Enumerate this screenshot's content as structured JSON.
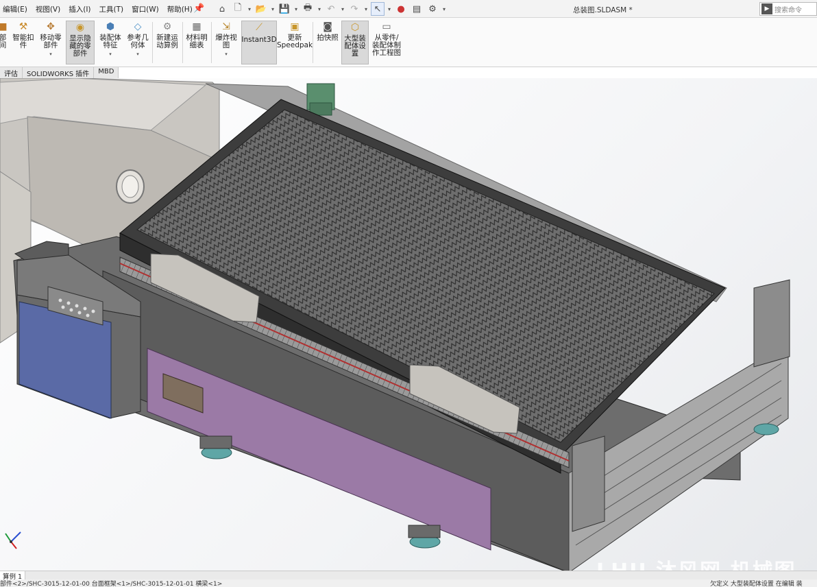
{
  "menu": [
    "编辑(E)",
    "视图(V)",
    "插入(I)",
    "工具(T)",
    "窗口(W)",
    "帮助(H)"
  ],
  "document_title": "总装图.SLDASM *",
  "search": {
    "placeholder": "搜索命令"
  },
  "ribbon": {
    "tools": [
      {
        "id": "part-fragment",
        "label": "部\n间",
        "icon": "part-icon"
      },
      {
        "id": "smart-fastener",
        "label": "智能扣\n件",
        "icon": "fastener-icon"
      },
      {
        "id": "move-component",
        "label": "移动零\n部件",
        "icon": "move-component-icon"
      },
      {
        "id": "show-hidden",
        "label": "显示隐\n藏的零\n部件",
        "icon": "show-hidden-icon"
      },
      {
        "id": "assembly-feature",
        "label": "装配体\n特征",
        "icon": "assembly-feature-icon"
      },
      {
        "id": "reference-geometry",
        "label": "参考几\n何体",
        "icon": "reference-geometry-icon"
      },
      {
        "id": "new-motion-study",
        "label": "新建运\n动算例",
        "icon": "motion-study-icon"
      },
      {
        "id": "bom",
        "label": "材料明\n细表",
        "icon": "bom-icon"
      },
      {
        "id": "exploded-view",
        "label": "爆炸视\n图",
        "icon": "exploded-view-icon"
      },
      {
        "id": "instant3d",
        "label": "Instant3D",
        "icon": "instant3d-icon"
      },
      {
        "id": "update-speedpak",
        "label": "更新\nSpeedpak",
        "icon": "speedpak-icon"
      },
      {
        "id": "snapshot",
        "label": "拍快照",
        "icon": "camera-icon"
      },
      {
        "id": "large-assembly",
        "label": "大型装\n配体设\n置",
        "icon": "large-assembly-icon"
      },
      {
        "id": "make-drawing",
        "label": "从零件/\n装配体制\n作工程图",
        "icon": "drawing-icon"
      }
    ]
  },
  "tabs": [
    "评估",
    "SOLIDWORKS 插件",
    "MBD"
  ],
  "model_tab": "算例 1",
  "status": {
    "left": "部件<2>/SHC-3015-12-01-00 台面框架<1>/SHC-3015-12-01-01 横梁<1>",
    "right": "欠定义   大型装配体设置   在编辑 装"
  },
  "watermark": "LHU 沐风网 机械图纸",
  "colors": {
    "frame": "#5a5a5a",
    "grid": "#7a7a7a",
    "panel_purple": "#9b7aa6",
    "control_box_blue": "#5a6aa6",
    "housing_gray": "#c9c6c1",
    "motor_green": "#5a8f6e",
    "foot_teal": "#5fa6a6"
  }
}
